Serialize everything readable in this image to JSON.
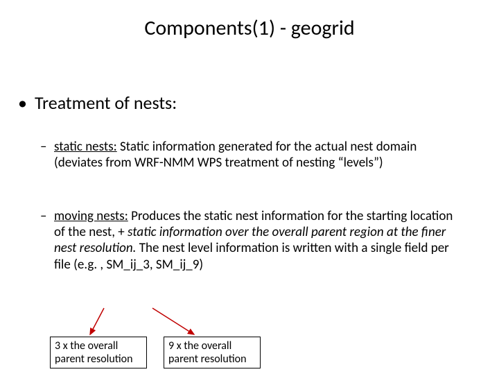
{
  "title": "Components(1) - geogrid",
  "bullet1": "Treatment of nests:",
  "sub1": {
    "label": "static nests:",
    "text": " Static information generated for the actual nest domain (deviates from WRF-NMM WPS treatment of nesting “levels”)"
  },
  "sub2": {
    "label": "moving nests:",
    "text_part1": " Produces the static nest information for the starting location of the nest,  + ",
    "text_italic": "static information over the overall parent region at the finer nest resolution.",
    "text_part2": "  The nest level information is written with a single field per file (e.g. , SM_ij_3, SM_ij_9)"
  },
  "box1": "3 x the overall parent resolution",
  "box2": "9 x the overall parent resolution",
  "arrow_color": "#c00000"
}
